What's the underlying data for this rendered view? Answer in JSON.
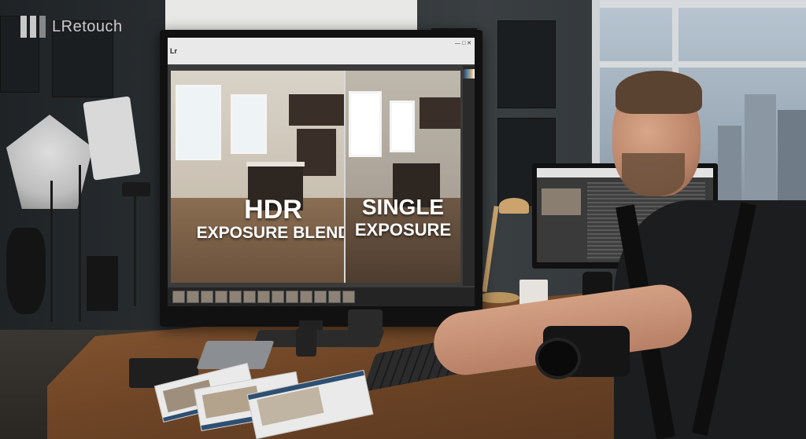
{
  "watermark": {
    "brand": "LRetouch",
    "icon": "lretouch-logo-icon"
  },
  "monitor": {
    "app_badge": "Lr",
    "compare_left": {
      "line1": "HDR",
      "line2": "EXPOSURE BLEND"
    },
    "compare_right": {
      "line1": "SINGLE",
      "line2": "EXPOSURE"
    }
  },
  "colors": {
    "overlay_text": "#ffffff",
    "desk_wood": "#7a4d2b",
    "screen_bg": "#3b3b3b"
  }
}
